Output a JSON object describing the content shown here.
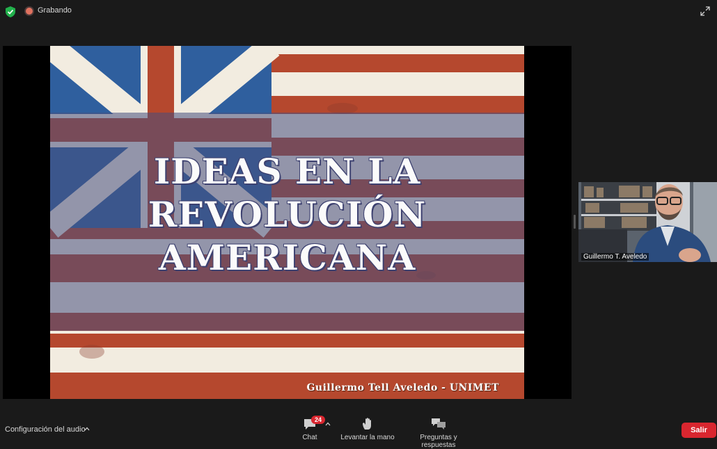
{
  "topbar": {
    "recording_label": "Grabando",
    "icons": [
      "shield-check-icon",
      "recording-icon",
      "fullscreen-icon"
    ]
  },
  "slide": {
    "title_lines": [
      "IDEAS EN LA",
      "REVOLUCIÓN",
      "AMERICANA"
    ],
    "author": "Guillermo Tell Aveledo - UNIMET",
    "colors": {
      "red": "#b5482e",
      "white": "#f2ece0",
      "blue": "#2f5f9e",
      "band": "#464e7d"
    }
  },
  "participant": {
    "name": "Guillermo T. Aveledo"
  },
  "bottombar": {
    "audio_label": "Configuración del audio",
    "chat_label": "Chat",
    "chat_count": "24",
    "raise_hand_label": "Levantar la mano",
    "qa_label": "Preguntas y respuestas",
    "leave_label": "Salir",
    "leave_color": "#d9262f"
  }
}
